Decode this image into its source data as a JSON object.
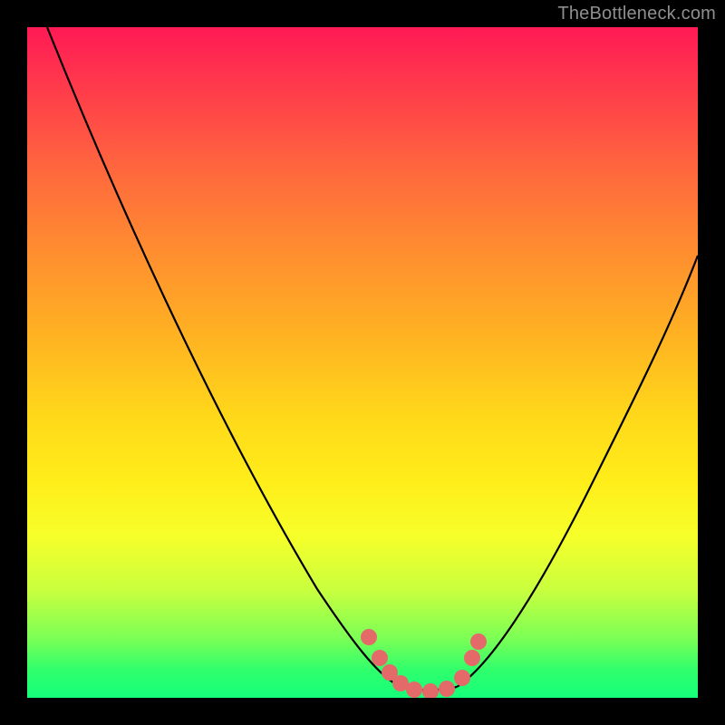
{
  "watermark": {
    "text": "TheBottleneck.com"
  },
  "chart_data": {
    "type": "line",
    "title": "",
    "xlabel": "",
    "ylabel": "",
    "xlim": [
      0,
      1
    ],
    "ylim": [
      0,
      1
    ],
    "grid": false,
    "legend": false,
    "description": "V-shaped bottleneck curve over a red→yellow→green vertical gradient. Left branch descends from the top-left corner to a flat minimum around x≈0.55–0.65, right branch rises toward the upper-right. A few pink dot markers sit near the minimum.",
    "series": [
      {
        "name": "left-branch",
        "x": [
          0.03,
          0.1,
          0.18,
          0.26,
          0.34,
          0.42,
          0.48,
          0.52,
          0.55
        ],
        "y": [
          1.0,
          0.86,
          0.72,
          0.58,
          0.44,
          0.3,
          0.18,
          0.08,
          0.02
        ]
      },
      {
        "name": "flat-minimum",
        "x": [
          0.55,
          0.58,
          0.61,
          0.64
        ],
        "y": [
          0.02,
          0.01,
          0.01,
          0.02
        ]
      },
      {
        "name": "right-branch",
        "x": [
          0.64,
          0.7,
          0.78,
          0.86,
          0.94,
          1.0
        ],
        "y": [
          0.02,
          0.1,
          0.24,
          0.4,
          0.55,
          0.66
        ]
      }
    ],
    "markers": {
      "name": "near-minimum-dots",
      "color": "#e46a6a",
      "points": [
        {
          "x": 0.508,
          "y": 0.09
        },
        {
          "x": 0.525,
          "y": 0.06
        },
        {
          "x": 0.54,
          "y": 0.038
        },
        {
          "x": 0.555,
          "y": 0.022
        },
        {
          "x": 0.575,
          "y": 0.012
        },
        {
          "x": 0.6,
          "y": 0.01
        },
        {
          "x": 0.625,
          "y": 0.014
        },
        {
          "x": 0.648,
          "y": 0.03
        },
        {
          "x": 0.662,
          "y": 0.06
        },
        {
          "x": 0.672,
          "y": 0.085
        }
      ]
    },
    "background_gradient": {
      "direction": "vertical",
      "stops": [
        {
          "pos": 0.0,
          "color": "#ff1a55"
        },
        {
          "pos": 0.5,
          "color": "#ffd81a"
        },
        {
          "pos": 1.0,
          "color": "#16ff7a"
        }
      ]
    }
  }
}
